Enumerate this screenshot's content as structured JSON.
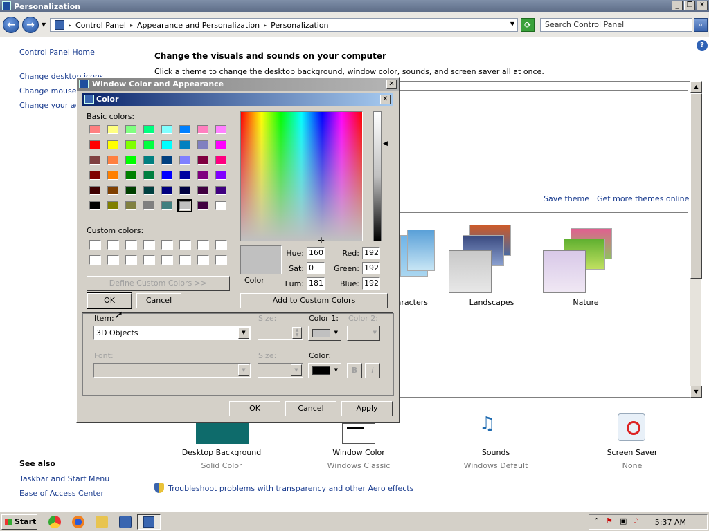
{
  "window": {
    "title": "Personalization",
    "controls": [
      "_",
      "❐",
      "✕"
    ]
  },
  "address": {
    "breadcrumb": [
      "Control Panel",
      "Appearance and Personalization",
      "Personalization"
    ],
    "search_placeholder": "Search Control Panel"
  },
  "sidebar": {
    "home": "Control Panel Home",
    "items": [
      "Change desktop icons",
      "Change mouse pointers",
      "Change your account picture"
    ],
    "see_also_title": "See also",
    "see_also": [
      "Taskbar and Start Menu",
      "Ease of Access Center"
    ]
  },
  "main": {
    "heading": "Change the visuals and sounds on your computer",
    "subheading": "Click a theme to change the desktop background, window color, sounds, and screen saver all at once.",
    "save_theme": "Save theme",
    "get_more_themes": "Get more themes online",
    "themes": [
      "Characters",
      "Landscapes",
      "Nature"
    ]
  },
  "bottom": [
    {
      "title": "Desktop Background",
      "value": "Solid Color"
    },
    {
      "title": "Window Color",
      "value": "Windows Classic"
    },
    {
      "title": "Sounds",
      "value": "Windows Default"
    },
    {
      "title": "Screen Saver",
      "value": "None"
    }
  ],
  "troubleshoot": "Troubleshoot problems with transparency and other Aero effects",
  "wca_dialog": {
    "title": "Window Color and Appearance",
    "item_label": "Item:",
    "item_value": "3D Objects",
    "size_label": "Size:",
    "color1_label": "Color 1:",
    "color2_label": "Color 2:",
    "font_label": "Font:",
    "font_size_label": "Size:",
    "font_color_label": "Color:",
    "bold": "B",
    "italic": "I",
    "ok": "OK",
    "cancel": "Cancel",
    "apply": "Apply",
    "color1_value": "#c0c0c0",
    "font_color_value": "#000000"
  },
  "color_dialog": {
    "title": "Color",
    "basic_colors_label": "Basic colors:",
    "custom_colors_label": "Custom colors:",
    "define_custom": "Define Custom Colors >>",
    "ok": "OK",
    "cancel": "Cancel",
    "add_custom": "Add to Custom Colors",
    "color_label": "Color",
    "hue_label": "Hue:",
    "sat_label": "Sat:",
    "lum_label": "Lum:",
    "red_label": "Red:",
    "green_label": "Green:",
    "blue_label": "Blue:",
    "hue": "160",
    "sat": "0",
    "lum": "181",
    "red": "192",
    "green": "192",
    "blue": "192",
    "basic_colors": [
      "#ff8080",
      "#ffff80",
      "#80ff80",
      "#00ff80",
      "#80ffff",
      "#0080ff",
      "#ff80c0",
      "#ff80ff",
      "#ff0000",
      "#ffff00",
      "#80ff00",
      "#00ff40",
      "#00ffff",
      "#0080c0",
      "#8080c0",
      "#ff00ff",
      "#804040",
      "#ff8040",
      "#00ff00",
      "#008080",
      "#004080",
      "#8080ff",
      "#800040",
      "#ff0080",
      "#800000",
      "#ff8000",
      "#008000",
      "#008040",
      "#0000ff",
      "#0000a0",
      "#800080",
      "#8000ff",
      "#400000",
      "#804000",
      "#004000",
      "#004040",
      "#000080",
      "#000040",
      "#400040",
      "#400080",
      "#000000",
      "#808000",
      "#808040",
      "#808080",
      "#408080",
      "#c0c0c0",
      "#400040",
      "#ffffff"
    ],
    "selected_index": 45
  },
  "taskbar": {
    "start": "Start",
    "clock": "5:37 AM"
  }
}
